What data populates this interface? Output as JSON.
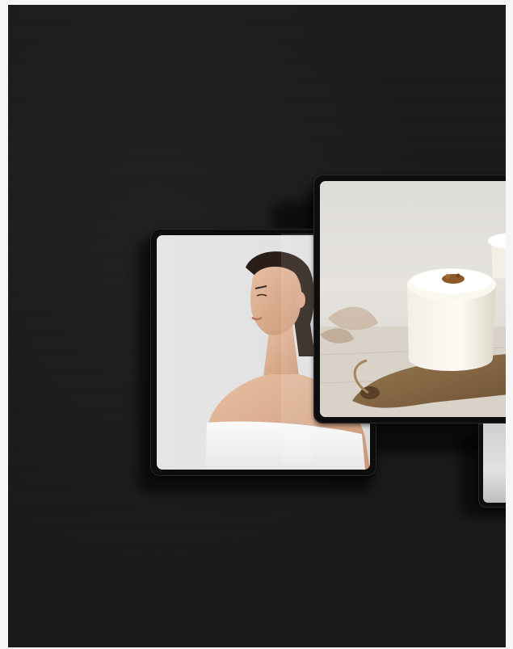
{
  "scene": {
    "background_color": "#1a1a1a",
    "page_color": "#f6f6f6",
    "devices": [
      {
        "name": "tablet-portrait-woman",
        "content": "woman-portrait-photo"
      },
      {
        "name": "tablet-coffee",
        "content": "coffee-cup-photo"
      },
      {
        "name": "tablet-partial",
        "content": "partial-photo"
      }
    ]
  }
}
